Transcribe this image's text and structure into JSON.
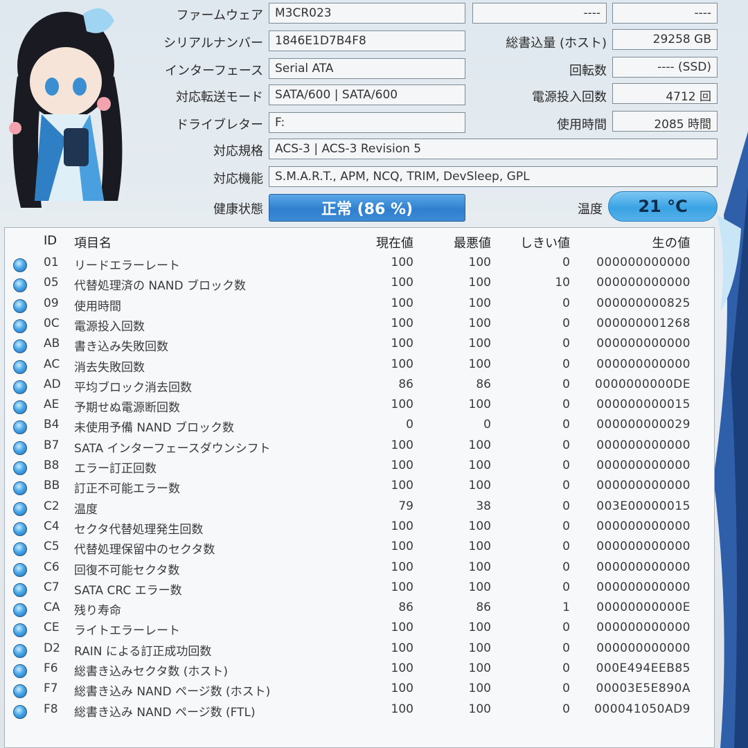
{
  "info": {
    "firmware_label": "ファームウェア",
    "firmware": "M3CR023",
    "serial_label": "シリアルナンバー",
    "serial": "1846E1D7B4F8",
    "interface_label": "インターフェース",
    "interface": "Serial ATA",
    "transfer_label": "対応転送モード",
    "transfer": "SATA/600 | SATA/600",
    "drive_label": "ドライブレター",
    "drive": "F:",
    "standard_label": "対応規格",
    "standard": "ACS-3 | ACS-3 Revision 5",
    "features_label": "対応機能",
    "features": "S.M.A.R.T., APM, NCQ, TRIM, DevSleep, GPL",
    "top_right_a": "----",
    "top_right_b": "----",
    "host_writes_label": "総書込量 (ホスト)",
    "host_writes": "29258 GB",
    "rotation_label": "回転数",
    "rotation": "---- (SSD)",
    "power_count_label": "電源投入回数",
    "power_count": "4712 回",
    "power_hours_label": "使用時間",
    "power_hours": "2085 時間",
    "health_label": "健康状態",
    "health": "正常 (86 %)",
    "temp_label": "温度",
    "temp": "21 °C"
  },
  "table": {
    "headers": {
      "id": "ID",
      "name": "項目名",
      "current": "現在値",
      "worst": "最悪値",
      "threshold": "しきい値",
      "raw": "生の値"
    },
    "rows": [
      {
        "id": "01",
        "name": "リードエラーレート",
        "current": "100",
        "worst": "100",
        "threshold": "0",
        "raw": "000000000000"
      },
      {
        "id": "05",
        "name": "代替処理済の NAND ブロック数",
        "current": "100",
        "worst": "100",
        "threshold": "10",
        "raw": "000000000000"
      },
      {
        "id": "09",
        "name": "使用時間",
        "current": "100",
        "worst": "100",
        "threshold": "0",
        "raw": "000000000825"
      },
      {
        "id": "0C",
        "name": "電源投入回数",
        "current": "100",
        "worst": "100",
        "threshold": "0",
        "raw": "000000001268"
      },
      {
        "id": "AB",
        "name": "書き込み失敗回数",
        "current": "100",
        "worst": "100",
        "threshold": "0",
        "raw": "000000000000"
      },
      {
        "id": "AC",
        "name": "消去失敗回数",
        "current": "100",
        "worst": "100",
        "threshold": "0",
        "raw": "000000000000"
      },
      {
        "id": "AD",
        "name": "平均ブロック消去回数",
        "current": "86",
        "worst": "86",
        "threshold": "0",
        "raw": "0000000000DE"
      },
      {
        "id": "AE",
        "name": "予期せぬ電源断回数",
        "current": "100",
        "worst": "100",
        "threshold": "0",
        "raw": "000000000015"
      },
      {
        "id": "B4",
        "name": "未使用予備 NAND ブロック数",
        "current": "0",
        "worst": "0",
        "threshold": "0",
        "raw": "000000000029"
      },
      {
        "id": "B7",
        "name": "SATA インターフェースダウンシフト",
        "current": "100",
        "worst": "100",
        "threshold": "0",
        "raw": "000000000000"
      },
      {
        "id": "B8",
        "name": "エラー訂正回数",
        "current": "100",
        "worst": "100",
        "threshold": "0",
        "raw": "000000000000"
      },
      {
        "id": "BB",
        "name": "訂正不可能エラー数",
        "current": "100",
        "worst": "100",
        "threshold": "0",
        "raw": "000000000000"
      },
      {
        "id": "C2",
        "name": "温度",
        "current": "79",
        "worst": "38",
        "threshold": "0",
        "raw": "003E00000015"
      },
      {
        "id": "C4",
        "name": "セクタ代替処理発生回数",
        "current": "100",
        "worst": "100",
        "threshold": "0",
        "raw": "000000000000"
      },
      {
        "id": "C5",
        "name": "代替処理保留中のセクタ数",
        "current": "100",
        "worst": "100",
        "threshold": "0",
        "raw": "000000000000"
      },
      {
        "id": "C6",
        "name": "回復不可能セクタ数",
        "current": "100",
        "worst": "100",
        "threshold": "0",
        "raw": "000000000000"
      },
      {
        "id": "C7",
        "name": "SATA CRC エラー数",
        "current": "100",
        "worst": "100",
        "threshold": "0",
        "raw": "000000000000"
      },
      {
        "id": "CA",
        "name": "残り寿命",
        "current": "86",
        "worst": "86",
        "threshold": "1",
        "raw": "00000000000E"
      },
      {
        "id": "CE",
        "name": "ライトエラーレート",
        "current": "100",
        "worst": "100",
        "threshold": "0",
        "raw": "000000000000"
      },
      {
        "id": "D2",
        "name": "RAIN による訂正成功回数",
        "current": "100",
        "worst": "100",
        "threshold": "0",
        "raw": "000000000000"
      },
      {
        "id": "F6",
        "name": "総書き込みセクタ数 (ホスト)",
        "current": "100",
        "worst": "100",
        "threshold": "0",
        "raw": "000E494EEB85"
      },
      {
        "id": "F7",
        "name": "総書き込み NAND ページ数 (ホスト)",
        "current": "100",
        "worst": "100",
        "threshold": "0",
        "raw": "00003E5E890A"
      },
      {
        "id": "F8",
        "name": "総書き込み NAND ページ数 (FTL)",
        "current": "100",
        "worst": "100",
        "threshold": "0",
        "raw": "000041050AD9"
      }
    ]
  }
}
